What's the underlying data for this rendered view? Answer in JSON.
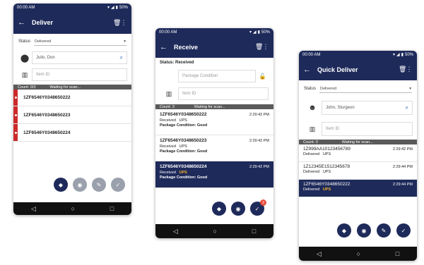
{
  "time": "00:00 AM",
  "battery": "50%",
  "deliver": {
    "title": "Deliver",
    "status_label": "Status",
    "status_value": "Delivered",
    "recipient": "Julio, Don",
    "item_placeholder": "Item ID",
    "count": "Count: 0/3",
    "waiting": "Waiting for scan...",
    "items": [
      {
        "tracking": "1ZF6546Y0348650222"
      },
      {
        "tracking": "1ZF6546Y0348650223"
      },
      {
        "tracking": "1ZF6546Y0348650224"
      }
    ]
  },
  "receive": {
    "title": "Receive",
    "status_line": "Status: Received",
    "package_placeholder": "Package Condition",
    "item_placeholder": "Item ID",
    "count": "Count: 3",
    "waiting": "Waiting for scan...",
    "badge": "3",
    "items": [
      {
        "tracking": "1ZF6546Y0348650222",
        "time": "2:29:42 PM",
        "status": "Received",
        "carrier": "UPS",
        "condition": "Package Condition: Good"
      },
      {
        "tracking": "1ZF6546Y0348650223",
        "time": "2:29:42 PM",
        "status": "Received",
        "carrier": "UPS",
        "condition": "Package Condition: Good"
      },
      {
        "tracking": "1ZF6546Y0348650224",
        "time": "2:29:42 PM",
        "status": "Received",
        "carrier": "UPS",
        "condition": "Package Condition: Good"
      }
    ]
  },
  "quick": {
    "title": "Quick Deliver",
    "status_label": "Status",
    "status_value": "Delivered",
    "recipient": "John, Sturgeon",
    "item_placeholder": "Item ID",
    "count": "Count: 0",
    "waiting": "Waiting for scan...",
    "items": [
      {
        "tracking": "1Z999AA10123456789",
        "time": "2:29:42 PM",
        "status": "Delivered",
        "carrier": "UPS"
      },
      {
        "tracking": "1Z12345E1512345678",
        "time": "2:29:44 PM",
        "status": "Delivered",
        "carrier": "UPS"
      },
      {
        "tracking": "1ZF6546Y0348650222",
        "time": "2:29:44 PM",
        "status": "Delivered",
        "carrier": "UPS"
      }
    ]
  },
  "colors": {
    "primary": "#1e2a5a",
    "alert": "#cc2a2a",
    "carrier_highlight": "#f3b52b",
    "count_bar": "#5a5a5a"
  }
}
